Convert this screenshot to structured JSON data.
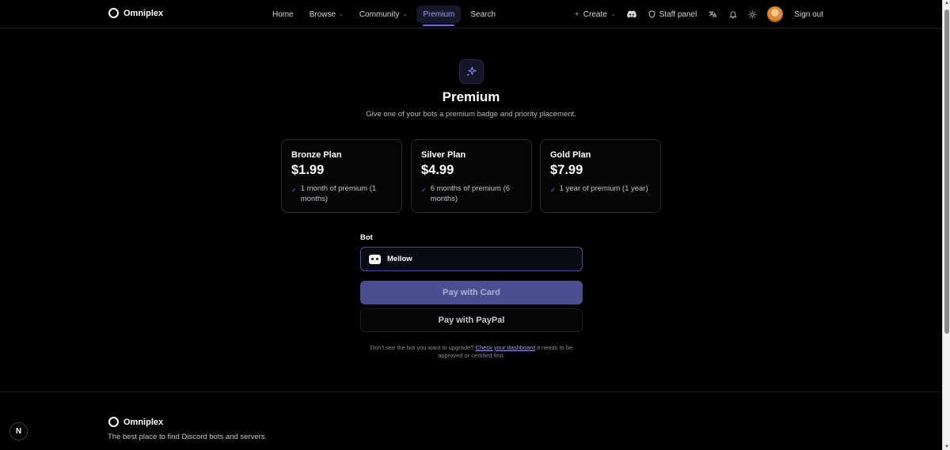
{
  "brand": {
    "name": "Omniplex"
  },
  "nav": {
    "home": "Home",
    "browse": "Browse",
    "community": "Community",
    "premium": "Premium",
    "search": "Search",
    "create": "Create",
    "staff_panel": "Staff panel",
    "sign_out": "Sign out"
  },
  "hero": {
    "title": "Premium",
    "subtitle": "Give one of your bots a premium badge and priority placement."
  },
  "plans": [
    {
      "name": "Bronze Plan",
      "price": "$1.99",
      "feature": "1 month of premium (1 months)"
    },
    {
      "name": "Silver Plan",
      "price": "$4.99",
      "feature": "6 months of premium (6 months)"
    },
    {
      "name": "Gold Plan",
      "price": "$7.99",
      "feature": "1 year of premium (1 year)"
    }
  ],
  "bot": {
    "label": "Bot",
    "selected": "Mellow"
  },
  "payment": {
    "card": "Pay with Card",
    "paypal": "Pay with PayPal"
  },
  "note": {
    "before": "Don't see the bot you want to upgrade?",
    "link": "Check your dashboard",
    "after": "it needs to be approved or certified first."
  },
  "footer": {
    "brand": "Omniplex",
    "tagline": "The best place to find Discord bots and servers."
  },
  "badge": {
    "letter": "N"
  },
  "colors": {
    "accent": "#6d70d8",
    "card_button": "#4b4e8f",
    "background": "#000000"
  }
}
